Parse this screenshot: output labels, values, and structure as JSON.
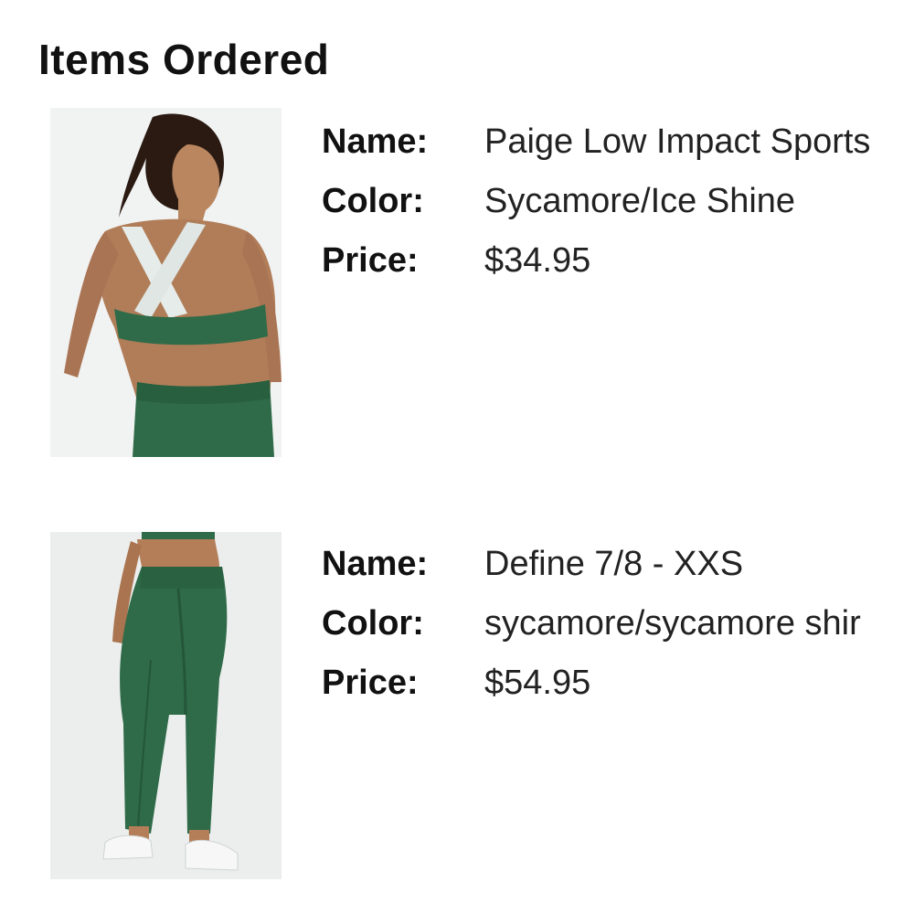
{
  "section": {
    "title": "Items Ordered"
  },
  "labels": {
    "name": "Name:",
    "color": "Color:",
    "price": "Price:"
  },
  "items": [
    {
      "image_icon": "sports-bra-product-photo",
      "name": "Paige Low Impact Sports",
      "color": "Sycamore/Ice Shine",
      "price": "$34.95"
    },
    {
      "image_icon": "leggings-product-photo",
      "name": "Define 7/8 - XXS",
      "color": "sycamore/sycamore shir",
      "price": "$54.95"
    }
  ],
  "colors": {
    "garment_green": "#2f6b48",
    "background": "#ffffff",
    "photo_bg": "#e9ecec"
  }
}
